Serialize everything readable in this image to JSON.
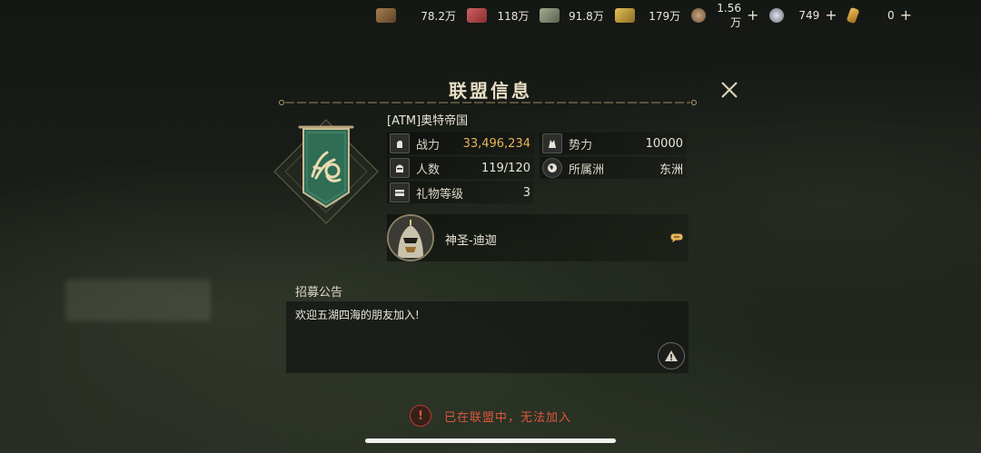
{
  "resources": [
    {
      "icon": "wood-icon",
      "value": "78.2万",
      "plus": false,
      "color": "#8b6a45"
    },
    {
      "icon": "meat-icon",
      "value": "118万",
      "plus": false,
      "color": "#b8484a"
    },
    {
      "icon": "stone-icon",
      "value": "91.8万",
      "plus": false,
      "color": "#8f957c"
    },
    {
      "icon": "gold-bar-icon",
      "value": "179万",
      "plus": false,
      "color": "#c9a43c"
    },
    {
      "icon": "bronze-coin-icon",
      "value": "1.56万",
      "plus": true,
      "color": "#b08c6a"
    },
    {
      "icon": "silver-coin-icon",
      "value": "749",
      "plus": true,
      "color": "#b7bcc4"
    },
    {
      "icon": "gold-ingot-icon",
      "value": "0",
      "plus": true,
      "color": "#d9a33b"
    }
  ],
  "plus_glyph": "+",
  "title": "联盟信息",
  "alliance_name": "[ATM]奥特帝国",
  "stats": {
    "power": {
      "label": "战力",
      "value": "33,496,234"
    },
    "influence": {
      "label": "势力",
      "value": "10000"
    },
    "members": {
      "label": "人数",
      "value": "119/120"
    },
    "continent": {
      "label": "所属洲",
      "value": "东洲"
    },
    "gift_level": {
      "label": "礼物等级",
      "value": "3"
    }
  },
  "leader": {
    "name": "神圣-迪迦"
  },
  "recruit": {
    "label": "招募公告",
    "text": "欢迎五湖四海的朋友加入!"
  },
  "warning": {
    "icon_text": "!",
    "text": "已在联盟中，无法加入"
  },
  "colors": {
    "accent_gold": "#e6b45a",
    "warning_red": "#e0563d",
    "banner_green": "#2f6d55"
  }
}
